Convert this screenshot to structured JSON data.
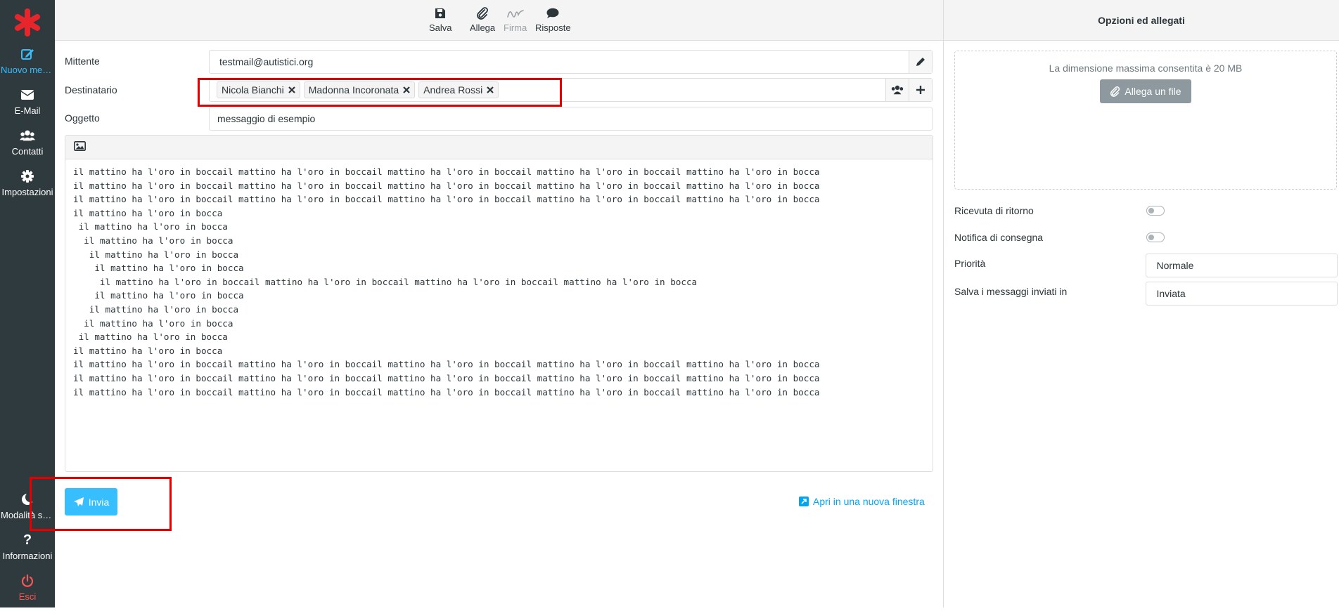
{
  "sidebar": {
    "logo": "asterisk-logo",
    "items": [
      {
        "label": "Nuovo mes...",
        "icon": "compose-icon",
        "active": true
      },
      {
        "label": "E-Mail",
        "icon": "envelope-icon"
      },
      {
        "label": "Contatti",
        "icon": "users-icon"
      },
      {
        "label": "Impostazioni",
        "icon": "gear-icon"
      }
    ],
    "bottom_items": [
      {
        "label": "Modalità sc...",
        "icon": "moon-icon"
      },
      {
        "label": "Informazioni",
        "icon": "question-icon"
      },
      {
        "label": "Esci",
        "icon": "power-icon"
      }
    ]
  },
  "toolbar": {
    "save": "Salva",
    "attach": "Allega",
    "signature": "Firma",
    "responses": "Risposte"
  },
  "compose": {
    "from_label": "Mittente",
    "from_value": "testmail@autistici.org",
    "to_label": "Destinatario",
    "recipients": [
      "Nicola Bianchi",
      "Madonna Incoronata",
      "Andrea Rossi"
    ],
    "subject_label": "Oggetto",
    "subject_value": "messaggio di esempio",
    "body": "il mattino ha l'oro in boccail mattino ha l'oro in boccail mattino ha l'oro in boccail mattino ha l'oro in boccail mattino ha l'oro in bocca\nil mattino ha l'oro in boccail mattino ha l'oro in boccail mattino ha l'oro in boccail mattino ha l'oro in boccail mattino ha l'oro in bocca\nil mattino ha l'oro in boccail mattino ha l'oro in boccail mattino ha l'oro in boccail mattino ha l'oro in boccail mattino ha l'oro in bocca\nil mattino ha l'oro in bocca\n il mattino ha l'oro in bocca\n  il mattino ha l'oro in bocca\n   il mattino ha l'oro in bocca\n    il mattino ha l'oro in bocca\n     il mattino ha l'oro in boccail mattino ha l'oro in boccail mattino ha l'oro in boccail mattino ha l'oro in bocca\n    il mattino ha l'oro in bocca\n   il mattino ha l'oro in bocca\n  il mattino ha l'oro in bocca\n il mattino ha l'oro in bocca\nil mattino ha l'oro in bocca\nil mattino ha l'oro in boccail mattino ha l'oro in boccail mattino ha l'oro in boccail mattino ha l'oro in boccail mattino ha l'oro in bocca\nil mattino ha l'oro in boccail mattino ha l'oro in boccail mattino ha l'oro in boccail mattino ha l'oro in boccail mattino ha l'oro in bocca\nil mattino ha l'oro in boccail mattino ha l'oro in boccail mattino ha l'oro in boccail mattino ha l'oro in boccail mattino ha l'oro in bocca",
    "send_label": "Invia",
    "open_new_window": "Apri in una nuova finestra"
  },
  "options": {
    "header": "Opzioni ed allegati",
    "max_size_hint": "La dimensione massima consentita è 20 MB",
    "attach_file": "Allega un file",
    "return_receipt": "Ricevuta di ritorno",
    "delivery_notice": "Notifica di consegna",
    "priority_label": "Priorità",
    "priority_value": "Normale",
    "save_sent_label": "Salva i messaggi inviati in",
    "save_sent_value": "Inviata"
  },
  "colors": {
    "sidebar_bg": "#2f3a3f",
    "accent": "#37beff",
    "logo": "#e6262a",
    "highlight": "#e30000",
    "logout": "#ff5552"
  }
}
